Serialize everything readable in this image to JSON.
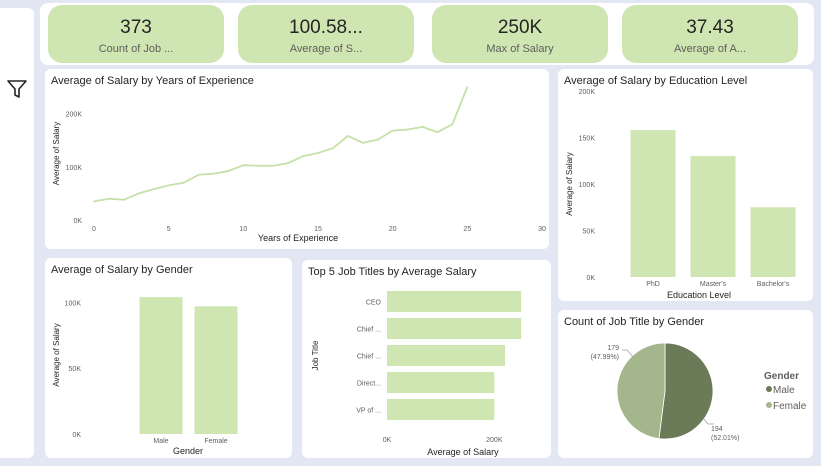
{
  "kpis": [
    {
      "value": "373",
      "label": "Count of Job ..."
    },
    {
      "value": "100.58...",
      "label": "Average of S..."
    },
    {
      "value": "250K",
      "label": "Max of Salary"
    },
    {
      "value": "37.43",
      "label": "Average of A..."
    }
  ],
  "colors": {
    "bar": "#cfe6b3",
    "line": "#c5e0a8",
    "pie_male": "#6b7a57",
    "pie_female": "#a4b68c",
    "kpi_bg": "#cfe6b3"
  },
  "filter_icon": "filter-icon",
  "chart_data": [
    {
      "type": "line",
      "title": "Average of Salary by Years of Experience",
      "xlabel": "Years of Experience",
      "ylabel": "Average of Salary",
      "x_ticks": [
        "0",
        "5",
        "10",
        "15",
        "20",
        "25",
        "30"
      ],
      "y_ticks": [
        "0K",
        "100K",
        "200K"
      ],
      "xlim": [
        0,
        30
      ],
      "ylim": [
        0,
        250000
      ],
      "x": [
        0,
        1,
        2,
        3,
        4,
        5,
        6,
        7,
        8,
        9,
        10,
        11,
        12,
        13,
        14,
        15,
        16,
        17,
        18,
        19,
        20,
        21,
        22,
        23,
        24,
        25
      ],
      "y": [
        35000,
        40000,
        38000,
        50000,
        58000,
        65000,
        70000,
        85000,
        87000,
        92000,
        103000,
        102000,
        102000,
        107000,
        120000,
        126000,
        135000,
        158000,
        145000,
        151000,
        168000,
        170000,
        175000,
        165000,
        180000,
        250000,
        200000
      ]
    },
    {
      "type": "bar",
      "title": "Average of Salary by Education Level",
      "xlabel": "Education Level",
      "ylabel": "Average of Salary",
      "categories": [
        "PhD",
        "Master's",
        "Bachelor's"
      ],
      "values": [
        158000,
        130000,
        75000
      ],
      "y_ticks": [
        "0K",
        "50K",
        "100K",
        "150K",
        "200K"
      ],
      "ylim": [
        0,
        200000
      ]
    },
    {
      "type": "bar",
      "title": "Average of Salary by Gender",
      "xlabel": "Gender",
      "ylabel": "Average of Salary",
      "categories": [
        "Male",
        "Female"
      ],
      "values": [
        104000,
        97000
      ],
      "y_ticks": [
        "0K",
        "50K",
        "100K"
      ],
      "ylim": [
        0,
        120000
      ]
    },
    {
      "type": "bar",
      "orientation": "horizontal",
      "title": "Top 5 Job Titles by Average Salary",
      "xlabel": "Average of Salary",
      "ylabel": "Job Title",
      "categories": [
        "CEO",
        "Chief ...",
        "Chief ...",
        "Direct...",
        "VP of ..."
      ],
      "values": [
        250000,
        250000,
        220000,
        200000,
        200000
      ],
      "x_ticks": [
        "0K",
        "200K"
      ],
      "xlim": [
        0,
        300000
      ]
    },
    {
      "type": "pie",
      "title": "Count of Job Title by Gender",
      "legend_title": "Gender",
      "legend_position": "right",
      "categories": [
        "Male",
        "Female"
      ],
      "values": [
        194,
        179
      ],
      "data_labels": [
        {
          "count": "194",
          "pct": "(52.01%)"
        },
        {
          "count": "179",
          "pct": "(47.99%)"
        }
      ]
    }
  ]
}
